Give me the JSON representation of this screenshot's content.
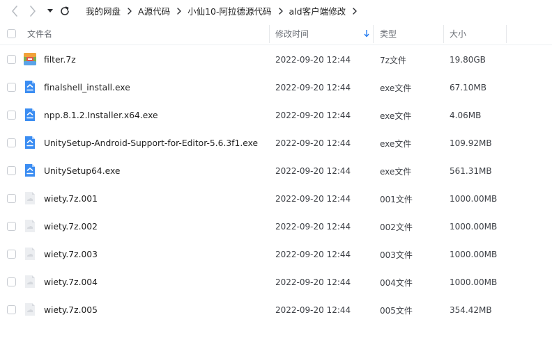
{
  "breadcrumb": [
    "我的网盘",
    "A源代码",
    "小仙10-阿拉德源代码",
    "ald客户端修改"
  ],
  "columns": {
    "name": "文件名",
    "mtime": "修改时间",
    "type": "类型",
    "size": "大小"
  },
  "colors": {
    "exe_icon": "#3b8df2",
    "archive_icon": "#7ab24f",
    "generic_icon": "#d5d8dd",
    "sort_arrow": "#2a7ff0"
  },
  "files": [
    {
      "name": "filter.7z",
      "mtime": "2022-09-20 12:44",
      "type": "7z文件",
      "size": "19.80GB",
      "icon": "archive-icon"
    },
    {
      "name": "finalshell_install.exe",
      "mtime": "2022-09-20 12:44",
      "type": "exe文件",
      "size": "67.10MB",
      "icon": "exe-icon"
    },
    {
      "name": "npp.8.1.2.Installer.x64.exe",
      "mtime": "2022-09-20 12:44",
      "type": "exe文件",
      "size": "4.06MB",
      "icon": "exe-icon"
    },
    {
      "name": "UnitySetup-Android-Support-for-Editor-5.6.3f1.exe",
      "mtime": "2022-09-20 12:44",
      "type": "exe文件",
      "size": "109.92MB",
      "icon": "exe-icon"
    },
    {
      "name": "UnitySetup64.exe",
      "mtime": "2022-09-20 12:44",
      "type": "exe文件",
      "size": "561.31MB",
      "icon": "exe-icon"
    },
    {
      "name": "wiety.7z.001",
      "mtime": "2022-09-20 12:44",
      "type": "001文件",
      "size": "1000.00MB",
      "icon": "generic-file-icon"
    },
    {
      "name": "wiety.7z.002",
      "mtime": "2022-09-20 12:44",
      "type": "002文件",
      "size": "1000.00MB",
      "icon": "generic-file-icon"
    },
    {
      "name": "wiety.7z.003",
      "mtime": "2022-09-20 12:44",
      "type": "003文件",
      "size": "1000.00MB",
      "icon": "generic-file-icon"
    },
    {
      "name": "wiety.7z.004",
      "mtime": "2022-09-20 12:44",
      "type": "004文件",
      "size": "1000.00MB",
      "icon": "generic-file-icon"
    },
    {
      "name": "wiety.7z.005",
      "mtime": "2022-09-20 12:44",
      "type": "005文件",
      "size": "354.42MB",
      "icon": "generic-file-icon"
    }
  ]
}
